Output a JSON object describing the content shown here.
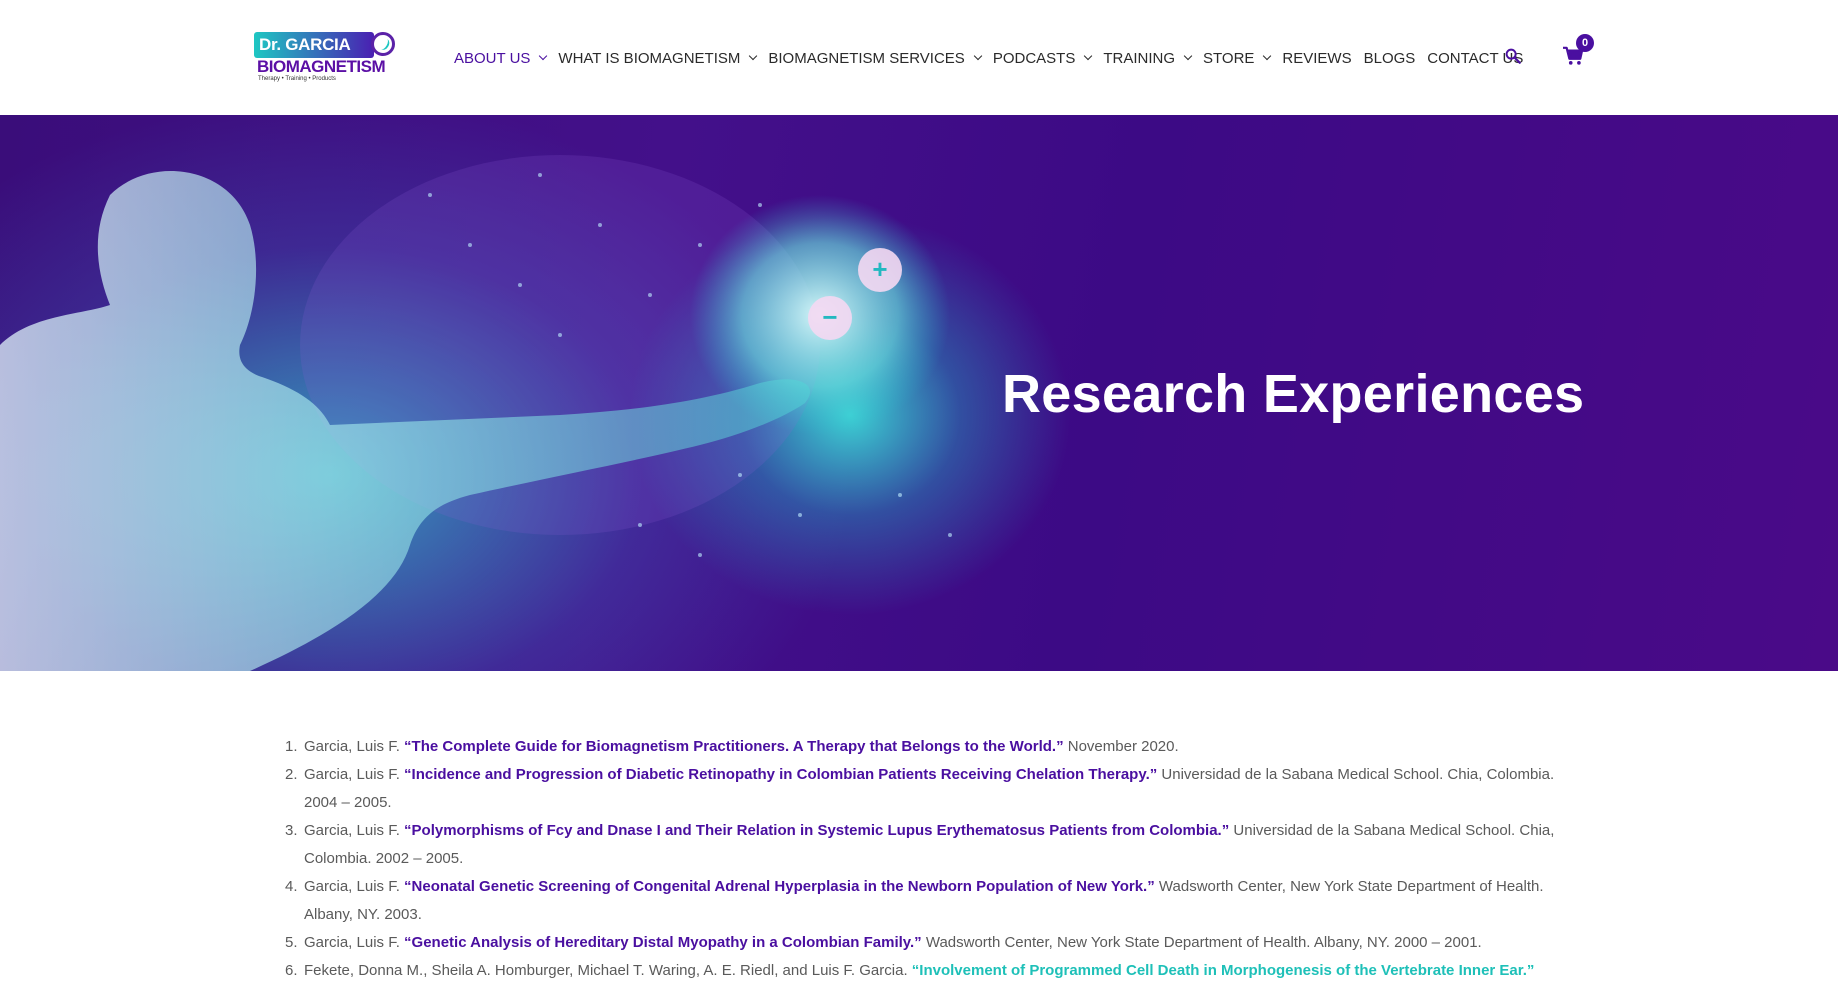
{
  "logo": {
    "line1": "Dr. GARCIA",
    "line2": "BIOMAGNETISM",
    "tagline": "Therapy • Training • Products"
  },
  "nav": {
    "items": [
      {
        "label": "ABOUT US",
        "dropdown": true,
        "active": true
      },
      {
        "label": "WHAT IS BIOMAGNETISM",
        "dropdown": true
      },
      {
        "label": "BIOMAGNETISM SERVICES",
        "dropdown": true
      },
      {
        "label": "PODCASTS",
        "dropdown": true
      },
      {
        "label": "TRAINING",
        "dropdown": true
      },
      {
        "label": "STORE",
        "dropdown": true
      },
      {
        "label": "REVIEWS",
        "dropdown": false
      },
      {
        "label": "BLOGS",
        "dropdown": false
      },
      {
        "label": "CONTACT US",
        "dropdown": false
      }
    ],
    "search_icon": "search-icon",
    "cart_icon": "cart-icon",
    "cart_count": "0"
  },
  "hero": {
    "title": "Research Experiences"
  },
  "references": [
    {
      "num": "1.",
      "author": "Garcia, Luis F.",
      "title": "“The Complete Guide for Biomagnetism Practitioners. A Therapy that Belongs to the World.”",
      "details": "November 2020."
    },
    {
      "num": "2.",
      "author": "Garcia, Luis F.",
      "title": "“Incidence and Progression of Diabetic Retinopathy in Colombian Patients Receiving Chelation Therapy.”",
      "details": "Universidad de la Sabana Medical School. Chia, Colombia. 2004 – 2005."
    },
    {
      "num": "3.",
      "author": "Garcia, Luis F.",
      "title": "“Polymorphisms of Fcy and Dnase I and Their Relation in Systemic Lupus Erythematosus Patients from Colombia.”",
      "details": "Universidad de la Sabana Medical School. Chia, Colombia. 2002 – 2005."
    },
    {
      "num": "4.",
      "author": "Garcia, Luis F.",
      "title": "“Neonatal Genetic Screening of Congenital Adrenal Hyperplasia in the Newborn Population of New York.”",
      "details": "Wadsworth Center, New York State Department of Health. Albany, NY. 2003."
    },
    {
      "num": "5.",
      "author": "Garcia, Luis F.",
      "title": "“Genetic Analysis of Hereditary Distal Myopathy in a Colombian Family.”",
      "details": "Wadsworth Center, New York State Department of Health. Albany, NY. 2000 – 2001."
    },
    {
      "num": "6.",
      "author": "Fekete, Donna M., Sheila A. Homburger, Michael T. Waring, A. E. Riedl, and Luis F. Garcia.",
      "title": "“Involvement of Programmed Cell Death in Morphogenesis of the Vertebrate Inner Ear.”",
      "details": "",
      "title_color": "teal"
    }
  ],
  "colors": {
    "brand_purple": "#4a0fa0",
    "brand_teal": "#1ec0b8",
    "hero_bg": "#3c0a85"
  }
}
